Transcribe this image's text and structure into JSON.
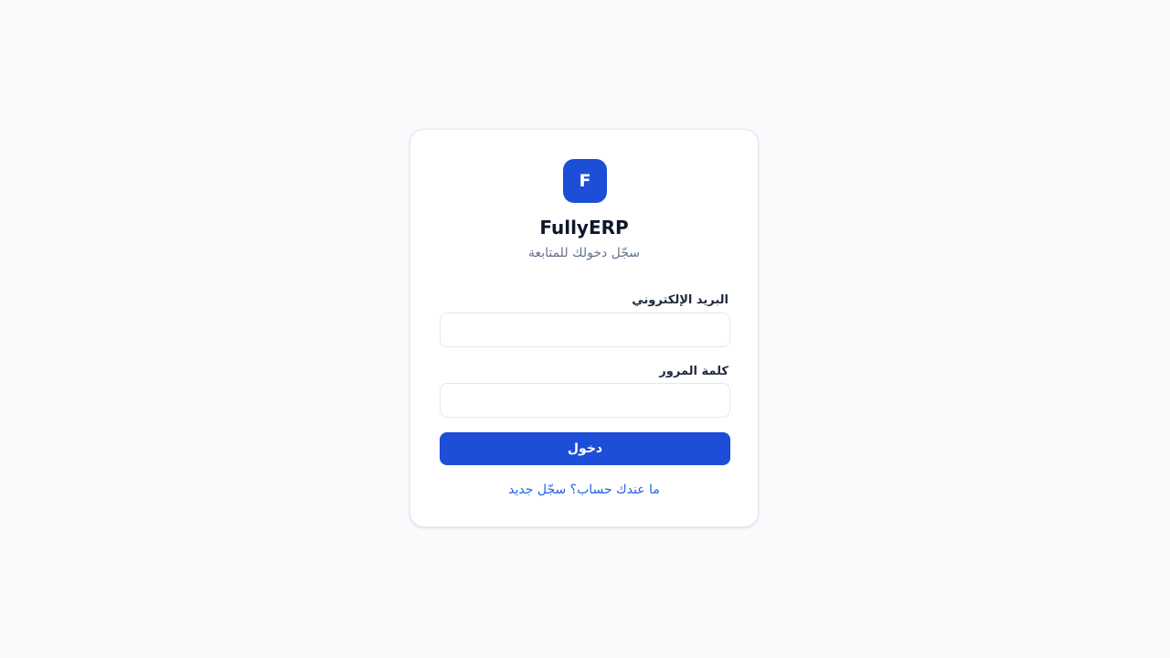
{
  "brand": {
    "logo_letter": "F",
    "title": "FullyERP",
    "subtitle": "سجّل دخولك للمتابعة"
  },
  "form": {
    "email_label": "البريد الإلكتروني",
    "email_value": "",
    "password_label": "كلمة المرور",
    "password_value": "",
    "submit_label": "دخول"
  },
  "footer": {
    "register_link": "ما عندك حساب؟ سجّل جديد"
  },
  "colors": {
    "background": "#f8fafc",
    "accent": "#1d4ed8",
    "link": "#2563eb",
    "title": "#0f172a",
    "muted": "#64748b"
  }
}
